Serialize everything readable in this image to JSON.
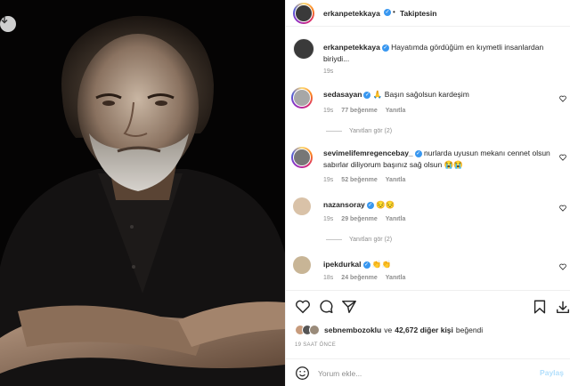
{
  "post": {
    "author": "erkanpetekkaya",
    "follow_status": "Takiptesin",
    "caption": "Hayatımda gördüğüm en kıymetli insanlardan biriydi...",
    "caption_age": "19s"
  },
  "icons": {
    "download": "download-icon",
    "more": "more-options-icon",
    "verified": "verified-badge-icon",
    "heart": "heart-icon",
    "comment": "comment-icon",
    "share": "share-icon",
    "save": "bookmark-icon",
    "emoji": "emoji-icon"
  },
  "comments": [
    {
      "user": "sedasayan",
      "text": "🙏 Başın sağolsun kardeşim",
      "age": "19s",
      "likes": "77 beğenme",
      "reply": "Yanıtla",
      "replies": "Yanıtları gör (2)"
    },
    {
      "user": "sevimelifemregencebay_",
      "text": "nurlarda uyusun mekanı cennet olsun sabırlar diliyorum başınız sağ olsun 😭😭",
      "age": "19s",
      "likes": "52 beğenme",
      "reply": "Yanıtla"
    },
    {
      "user": "nazansoray",
      "text": "😔😔",
      "age": "19s",
      "likes": "29 beğenme",
      "reply": "Yanıtla",
      "replies": "Yanıtları gör (2)"
    },
    {
      "user": "ipekdurkal",
      "text": "👏👏",
      "age": "18s",
      "likes": "24 beğenme",
      "reply": "Yanıtla"
    }
  ],
  "likes": {
    "first_user": "sebnembozoklu",
    "and": "ve",
    "others": "42,672 diğer kişi",
    "suffix": "beğendi"
  },
  "post_time": "19 SAAT ÖNCE",
  "add_comment": {
    "placeholder": "Yorum ekle...",
    "button": "Paylaş"
  },
  "colors": {
    "verified": "#3897f0",
    "link_disabled": "#b2dffc",
    "muted": "#8e8e8e"
  }
}
